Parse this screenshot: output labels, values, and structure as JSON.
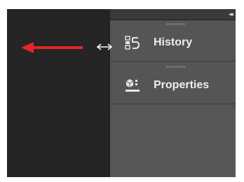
{
  "panels": [
    {
      "label": "History",
      "icon": "history-icon"
    },
    {
      "label": "Properties",
      "icon": "properties-icon"
    }
  ],
  "dock": {
    "collapse_icon": "collapse-panels-icon",
    "collapse_glyph": "◂◂"
  },
  "annotations": {
    "arrow_icon": "red-arrow-left-icon",
    "arrow_color": "#e8232a",
    "cursor_icon": "horizontal-resize-cursor-icon"
  },
  "colors": {
    "workspace": "#252525",
    "panel": "#555555",
    "header": "#3a3a3a",
    "label": "#eeeeee"
  }
}
